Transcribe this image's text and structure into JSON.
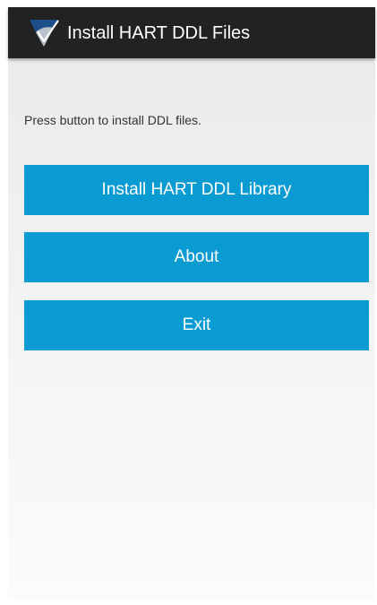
{
  "app": {
    "title": "Install HART DDL Files",
    "icon": "shield-check-icon"
  },
  "main": {
    "instruction": "Press button to install DDL files.",
    "buttons": {
      "install_label": "Install HART DDL Library",
      "about_label": "About",
      "exit_label": "Exit"
    }
  },
  "colors": {
    "action_bar": "#222222",
    "button": "#0a9bd3",
    "background": "#eeeeee"
  }
}
